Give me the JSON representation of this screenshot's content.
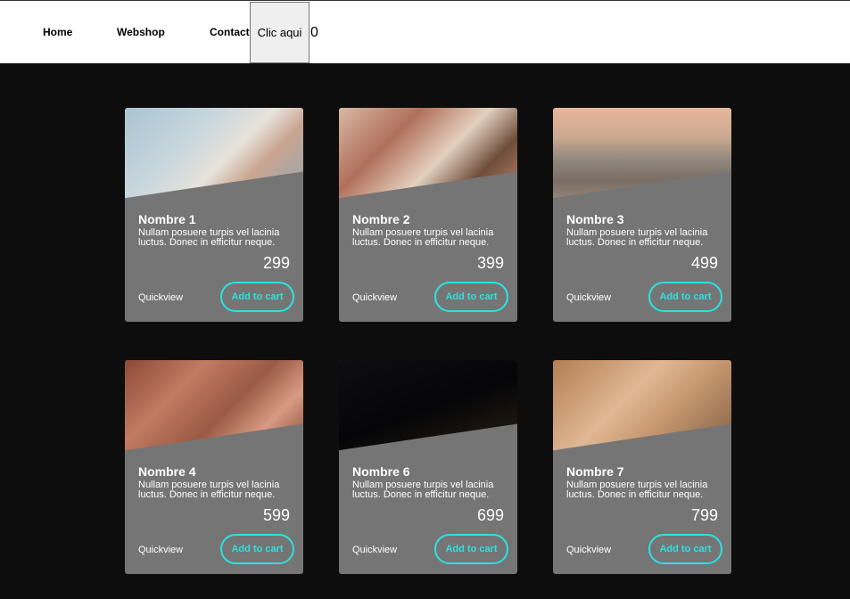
{
  "nav": {
    "home": "Home",
    "webshop": "Webshop",
    "contact": "Contact",
    "click_button": "Clic aqui",
    "cart_count": "0"
  },
  "products": [
    {
      "name": "Nombre 1",
      "description": "Nullam posuere turpis vel lacinia luctus. Donec in efficitur neque.",
      "price": "299",
      "quickview": "Quickview",
      "add_label": "Add to cart"
    },
    {
      "name": "Nombre 2",
      "description": "Nullam posuere turpis vel lacinia luctus. Donec in efficitur neque.",
      "price": "399",
      "quickview": "Quickview",
      "add_label": "Add to cart"
    },
    {
      "name": "Nombre 3",
      "description": "Nullam posuere turpis vel lacinia luctus. Donec in efficitur neque.",
      "price": "499",
      "quickview": "Quickview",
      "add_label": "Add to cart"
    },
    {
      "name": "Nombre 4",
      "description": "Nullam posuere turpis vel lacinia luctus. Donec in efficitur neque.",
      "price": "599",
      "quickview": "Quickview",
      "add_label": "Add to cart"
    },
    {
      "name": "Nombre 6",
      "description": "Nullam posuere turpis vel lacinia luctus. Donec in efficitur neque.",
      "price": "699",
      "quickview": "Quickview",
      "add_label": "Add to cart"
    },
    {
      "name": "Nombre 7",
      "description": "Nullam posuere turpis vel lacinia luctus. Donec in efficitur neque.",
      "price": "799",
      "quickview": "Quickview",
      "add_label": "Add to cart"
    }
  ],
  "colors": {
    "background": "#0d0d0d",
    "card": "#757575",
    "accent": "#2de1e1"
  }
}
